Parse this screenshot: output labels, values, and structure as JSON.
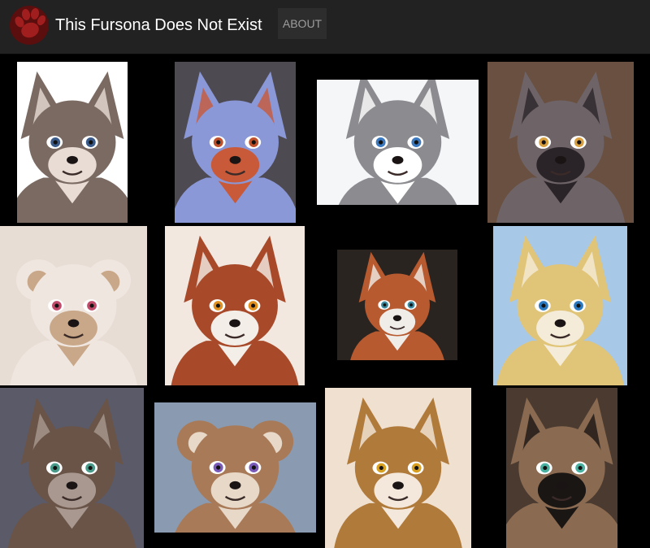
{
  "brand": {
    "title": "This Fursona Does Not Exist",
    "logo_icon": "paw-print-icon",
    "logo_color": "#8b1a1a"
  },
  "nav": {
    "about_label": "ABOUT"
  },
  "colors": {
    "navbar_bg": "#222222",
    "page_bg": "#000000",
    "nav_link": "#9d9d9d"
  },
  "portraits": [
    {
      "name": "grey-wolf-portrait",
      "bg": "#ffffff",
      "fur": "#7a6a62",
      "accent": "#e8dcd4",
      "eye": "#3a5a8a",
      "ear": "pointed"
    },
    {
      "name": "blue-fox-portrait",
      "bg": "#4e4a52",
      "fur": "#8a98d8",
      "accent": "#c85a3a",
      "eye": "#c0502a",
      "ear": "pointed"
    },
    {
      "name": "grey-husky-portrait",
      "bg": "#f4f6f8",
      "fur": "#8c8c90",
      "accent": "#ffffff",
      "eye": "#3a78c0",
      "ear": "pointed"
    },
    {
      "name": "dark-hair-portrait",
      "bg": "#6a5040",
      "fur": "#6e6468",
      "accent": "#2a2428",
      "eye": "#d8a040",
      "ear": "pointed"
    },
    {
      "name": "blonde-rabbit-portrait",
      "bg": "#e8ddd4",
      "fur": "#f0e6e0",
      "accent": "#c8a888",
      "eye": "#c04a6a",
      "ear": "round"
    },
    {
      "name": "red-brown-fox-portrait",
      "bg": "#f2e8e0",
      "fur": "#a84a2a",
      "accent": "#f4eee8",
      "eye": "#e09020",
      "ear": "pointed"
    },
    {
      "name": "red-panda-portrait",
      "bg": "#2a2420",
      "fur": "#b85a30",
      "accent": "#f0ece8",
      "eye": "#3a8aa0",
      "ear": "pointed"
    },
    {
      "name": "yellow-wolf-portrait",
      "bg": "#a8c8e8",
      "fur": "#e0c478",
      "accent": "#f4ecd8",
      "eye": "#2a78c0",
      "ear": "pointed"
    },
    {
      "name": "brown-wolf-portrait",
      "bg": "#5a5a68",
      "fur": "#6a5448",
      "accent": "#a89890",
      "eye": "#4a9a8a",
      "ear": "pointed"
    },
    {
      "name": "brown-cat-portrait",
      "bg": "#8a9ab0",
      "fur": "#a87a58",
      "accent": "#e8d8c8",
      "eye": "#7a5ab8",
      "ear": "round"
    },
    {
      "name": "golden-fox-girl-portrait",
      "bg": "#f0e0d0",
      "fur": "#b07a3a",
      "accent": "#f4e8dc",
      "eye": "#d8a020",
      "ear": "pointed"
    },
    {
      "name": "black-hair-jackal-portrait",
      "bg": "#4a3a30",
      "fur": "#8a6a50",
      "accent": "#1a1614",
      "eye": "#4ab0a0",
      "ear": "pointed"
    }
  ]
}
